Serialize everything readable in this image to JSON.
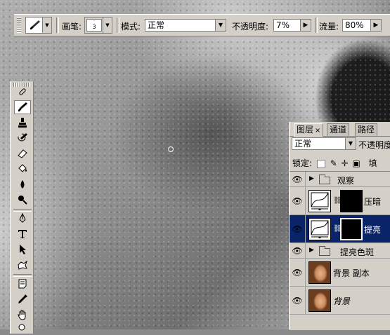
{
  "options_bar": {
    "brush_label": "画笔:",
    "brush_size": "3",
    "mode_label": "模式:",
    "mode_value": "正常",
    "opacity_label": "不透明度:",
    "opacity_value": "7%",
    "flow_label": "流量:",
    "flow_value": "80%"
  },
  "toolbox": {
    "tools": [
      "healing-brush-icon",
      "brush-icon",
      "clone-stamp-icon",
      "history-brush-icon",
      "eraser-icon",
      "paint-bucket-icon",
      "blur-icon",
      "dodge-icon",
      "pen-icon",
      "type-icon",
      "path-selection-icon",
      "custom-shape-icon",
      "notes-icon",
      "eyedropper-icon",
      "hand-icon",
      "zoom-icon"
    ],
    "active": "brush-icon"
  },
  "layers_panel": {
    "tabs": [
      {
        "label": "图层",
        "close": "×",
        "active": true
      },
      {
        "label": "通道",
        "active": false
      },
      {
        "label": "路径",
        "active": false
      }
    ],
    "blend_mode": "正常",
    "opacity_label": "不透明度",
    "lock_label": "锁定:",
    "fill_label": "填",
    "layers": [
      {
        "name": "观察",
        "type": "group",
        "visible": true,
        "selected": false
      },
      {
        "name": "压暗",
        "type": "adjustment",
        "visible": true,
        "selected": false
      },
      {
        "name": "提亮",
        "type": "adjustment",
        "visible": true,
        "selected": true
      },
      {
        "name": "提亮色斑",
        "type": "group",
        "visible": true,
        "selected": false
      },
      {
        "name": "背景 副本",
        "type": "image",
        "visible": true,
        "selected": false
      },
      {
        "name": "背景",
        "type": "image",
        "visible": true,
        "selected": false,
        "italic": true
      }
    ]
  },
  "colors": {
    "panel_bg": "#d4d0c8",
    "selection": "#0a246a"
  }
}
